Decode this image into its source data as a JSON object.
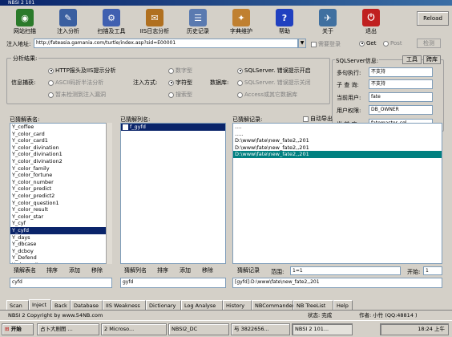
{
  "window": {
    "title": "NBSI 2 101"
  },
  "toolbar": [
    {
      "label": "网站扫描",
      "name": "site-scan",
      "color": "#2a7a2a",
      "glyph": "◉"
    },
    {
      "label": "注入分析",
      "name": "inject-analysis",
      "color": "#3a5fa0",
      "glyph": "✎"
    },
    {
      "label": "扫描及工具",
      "name": "scan-tools",
      "color": "#4060b0",
      "glyph": "⚙"
    },
    {
      "label": "IIS日志分析",
      "name": "iis-log",
      "color": "#b07020",
      "glyph": "✉"
    },
    {
      "label": "历史记录",
      "name": "history",
      "color": "#5a7ab0",
      "glyph": "☰"
    },
    {
      "label": "字典维护",
      "name": "dictionary",
      "color": "#c08030",
      "glyph": "✦"
    },
    {
      "label": "帮助",
      "name": "help",
      "color": "#2040c0",
      "glyph": "?"
    },
    {
      "label": "关于",
      "name": "about",
      "color": "#4070a0",
      "glyph": "✈"
    },
    {
      "label": "退出",
      "name": "exit",
      "color": "#c02020",
      "glyph": "⏻"
    }
  ],
  "reload_label": "Reload",
  "url": {
    "label": "注入地址:",
    "value": "http://fateasia.gamania.com/turtle/index.asp?sid=E00001",
    "need_login": "需要登录",
    "get": "Get",
    "post": "Post",
    "detect": "检测"
  },
  "analysis": {
    "title": "分析结果:",
    "info_capture": "信息捕获:",
    "http_error": "HTTP报头及IIS提示分析",
    "ascii": "ASCII码折半法分析",
    "not_detected": "暂未检测到注入漏洞",
    "inject_method": "注入方式:",
    "numeric": "数字型",
    "string": "字符型",
    "search": "搜索型",
    "db_label": "数据库:",
    "sqlserver_on": "SQLServer. 错误提示开启",
    "sqlserver_off": "SQLServer. 错误提示关闭",
    "access": "Access或其它数据库"
  },
  "sqlinfo": {
    "title": "SQLServer信息:",
    "tools": "工具",
    "cross": "跨库",
    "multi_exec_label": "多句执行:",
    "multi_exec": "不支持",
    "subquery_label": "子 查 询:",
    "subquery": "不支持",
    "user_label": "当前用户:",
    "user": "fate",
    "perm_label": "用户权限:",
    "perm": "DB_OWNER",
    "db_label": "当 前 库:",
    "db": "fatemaster_sql"
  },
  "tables": {
    "label": "已猜解表名:",
    "items": [
      "Y_coffee",
      "Y_color_card",
      "Y_color_card1",
      "Y_color_divination",
      "Y_color_divination1",
      "Y_color_divination2",
      "Y_color_family",
      "Y_color_fortune",
      "Y_color_number",
      "Y_color_predict",
      "Y_color_predict2",
      "Y_color_question1",
      "Y_color_result",
      "Y_color_star",
      "Y_cyf",
      "Y_cyfd",
      "Y_days",
      "Y_dbcase",
      "Y_dcboy",
      "Y_Defend",
      "Y_demosite"
    ],
    "selected": "Y_cyfd",
    "buttons": [
      "猜解表名",
      "排序",
      "添加",
      "移除"
    ],
    "input": "cyfd"
  },
  "columns": {
    "label": "已猜解列名:",
    "items": [
      "f_gyfd"
    ],
    "buttons": [
      "猜解列名",
      "排序",
      "添加",
      "移除"
    ],
    "input": "gyfd"
  },
  "records": {
    "label": "已猜解记录:",
    "auto_export": "自动导出",
    "rows": [
      "....",
      ".....",
      "D:\\www\\fate\\new_fate2,,201",
      "D:\\www\\fate\\new_fate2,,201",
      "D:\\www\\fate\\new_fate2,,201"
    ],
    "button": "猜解记录",
    "range_label": "范围:",
    "range": "1=1",
    "start_label": "开始:",
    "start": "1",
    "result": "[gyfd]:D:\\www\\fate\\new_fate2,,201"
  },
  "tabs": [
    "Scan",
    "Inject",
    "Back",
    "Database",
    "IIS Weakness",
    "Dictionary",
    "Log Analyse",
    "History",
    "NBCommander",
    "NB TreeList",
    "Help"
  ],
  "status": {
    "copyright": "NBSI 2 Copyright by www.54NB.com",
    "state": "状态: 完成",
    "author": "作者: 小竹 (QQ:48814 )"
  },
  "taskbar": {
    "start": "开始",
    "tasks": [
      "占卜大剧图 ...",
      "2 Microso...",
      "NBSI2_DC",
      "与 3822656...",
      "NBSI 2 101..."
    ],
    "time": "18:24 上午"
  }
}
